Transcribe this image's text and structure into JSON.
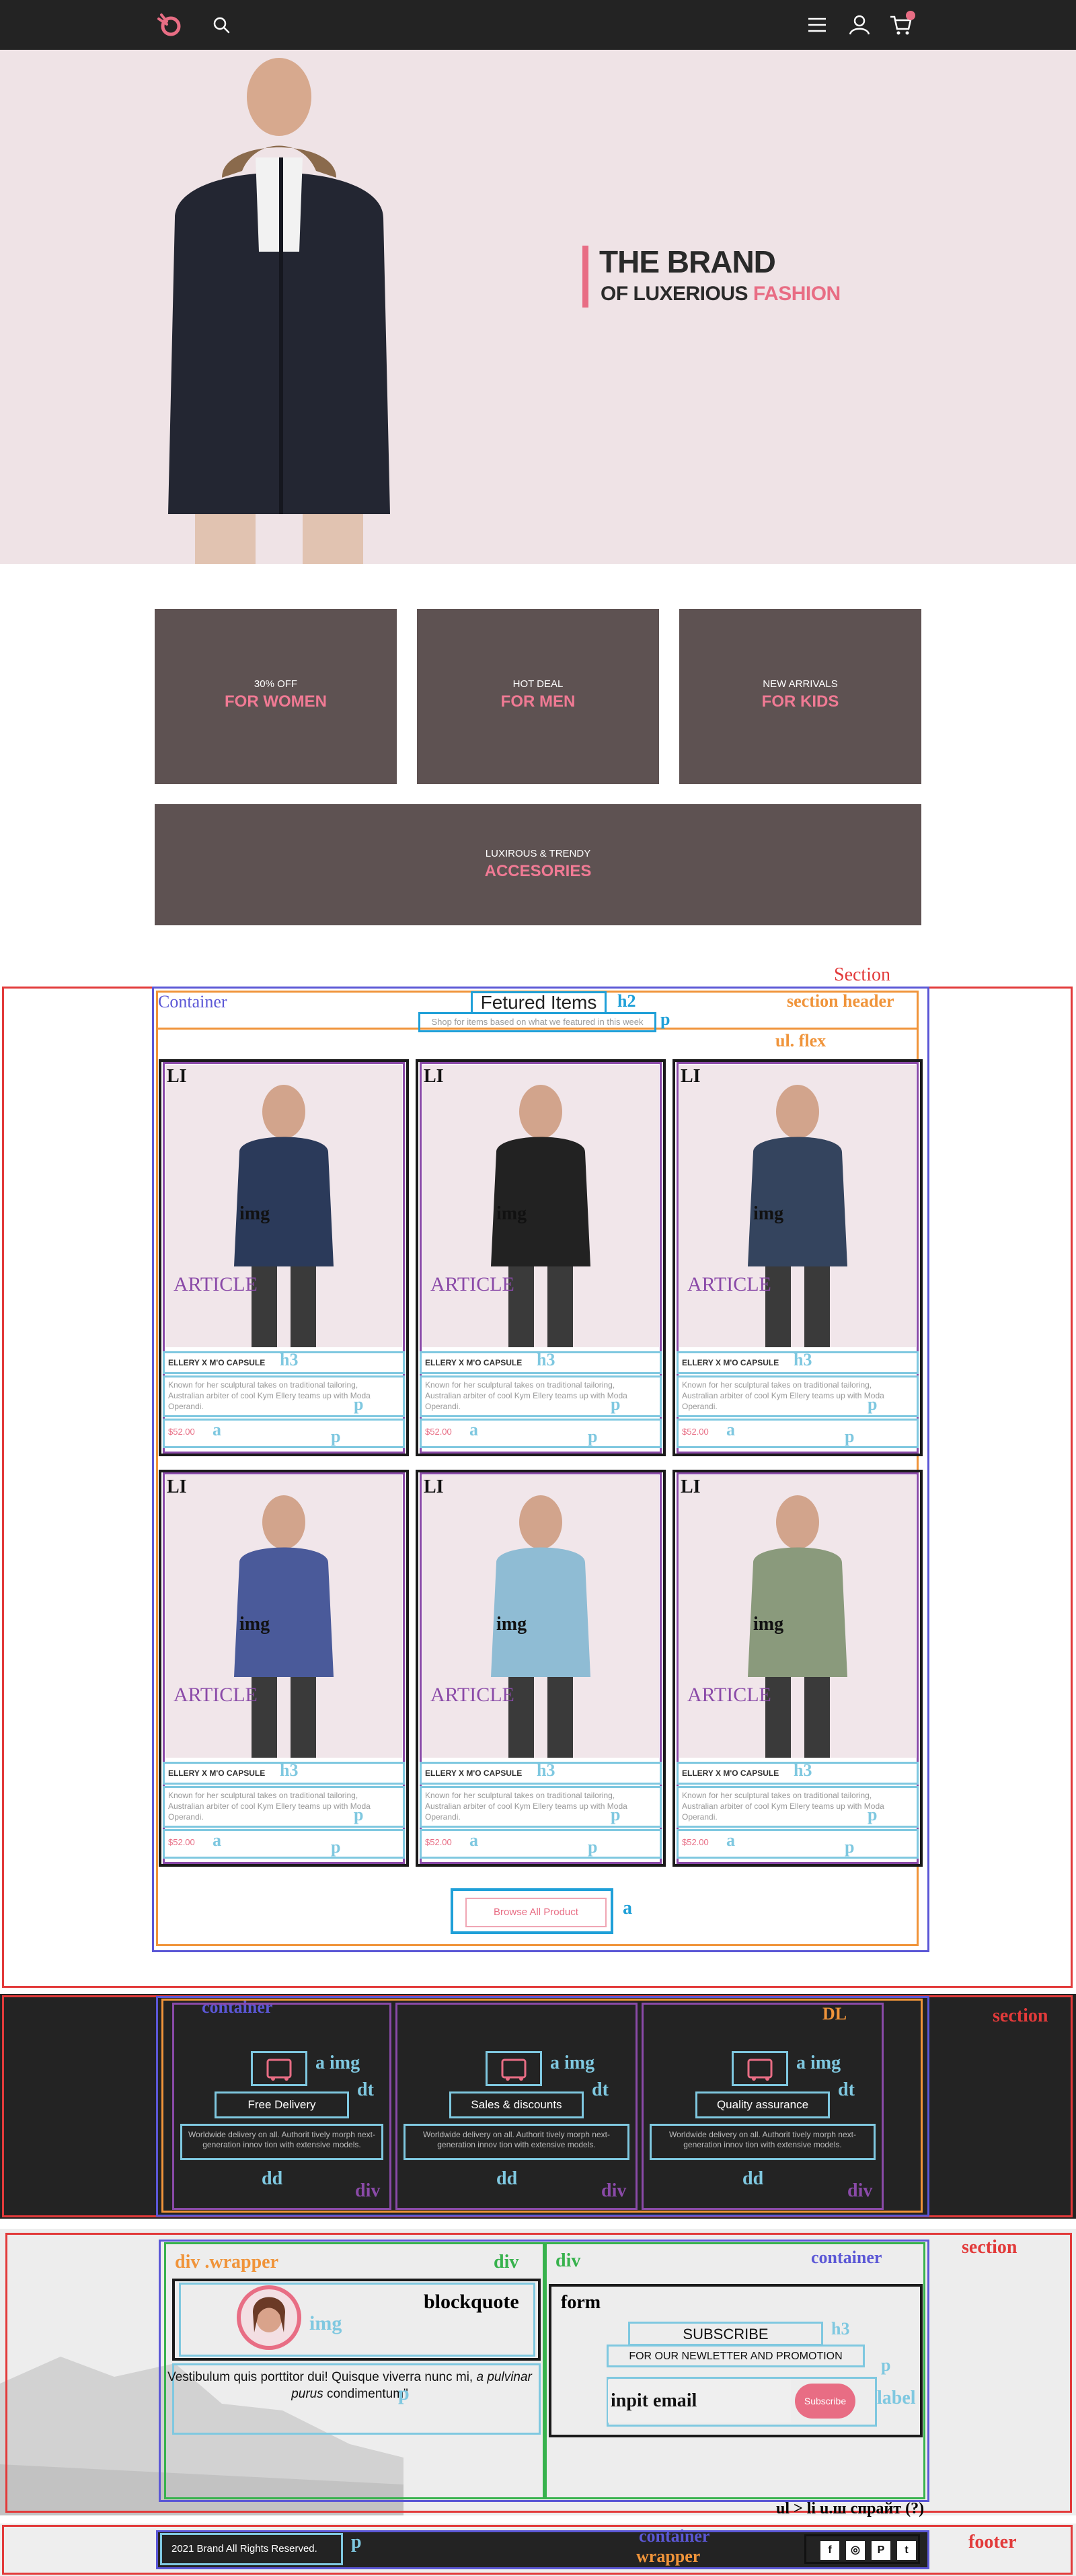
{
  "header": {
    "logo_icon": "brand-logo-icon",
    "search_icon": "search-icon",
    "menu_icon": "hamburger-menu-icon",
    "user_icon": "user-icon",
    "cart_icon": "cart-icon",
    "brand_color": "#e86d84"
  },
  "hero": {
    "title": "THE BRAND",
    "subtitle_prefix": "OF LUXERIOUS ",
    "subtitle_accent": "FASHION"
  },
  "promos": [
    {
      "small": "30% OFF",
      "big": "FOR WOMEN"
    },
    {
      "small": "HOT DEAL",
      "big": "FOR MEN"
    },
    {
      "small": "NEW ARRIVALS",
      "big": "FOR KIDS"
    }
  ],
  "promo_wide": {
    "small": "LUXIROUS & TRENDY",
    "big": "ACCESORIES"
  },
  "featured": {
    "title": "Fetured Items",
    "subtitle": "Shop for items based on what we featured in this week",
    "browse_label": "Browse All Product",
    "annotations": {
      "section": "Section",
      "container": "Container",
      "section_header": "section header",
      "h2": "h2",
      "p": "p",
      "ul_flex": "ul. flex",
      "li": "LI",
      "img": "img",
      "article": "ARTICLE",
      "h3": "h3",
      "a": "a"
    },
    "products": [
      {
        "name": "ELLERY X M'O CAPSULE",
        "desc": "Known for her sculptural takes on traditional tailoring, Australian arbiter of cool Kym Ellery teams up with Moda Operandi.",
        "price": "$52.00"
      },
      {
        "name": "ELLERY X M'O CAPSULE",
        "desc": "Known for her sculptural takes on traditional tailoring, Australian arbiter of cool Kym Ellery teams up with Moda Operandi.",
        "price": "$52.00"
      },
      {
        "name": "ELLERY X M'O CAPSULE",
        "desc": "Known for her sculptural takes on traditional tailoring, Australian arbiter of cool Kym Ellery teams up with Moda Operandi.",
        "price": "$52.00"
      },
      {
        "name": "ELLERY X M'O CAPSULE",
        "desc": "Known for her sculptural takes on traditional tailoring, Australian arbiter of cool Kym Ellery teams up with Moda Operandi.",
        "price": "$52.00"
      },
      {
        "name": "ELLERY X M'O CAPSULE",
        "desc": "Known for her sculptural takes on traditional tailoring, Australian arbiter of cool Kym Ellery teams up with Moda Operandi.",
        "price": "$52.00"
      },
      {
        "name": "ELLERY X M'O CAPSULE",
        "desc": "Known for her sculptural takes on traditional tailoring, Australian arbiter of cool Kym Ellery teams up with Moda Operandi.",
        "price": "$52.00"
      }
    ]
  },
  "features": {
    "annotations": {
      "container": "container",
      "dl": "DL",
      "section": "section",
      "a_img": "a img",
      "dt": "dt",
      "dd": "dd",
      "div": "div"
    },
    "items": [
      {
        "title": "Free Delivery",
        "desc": "Worldwide delivery on all. Authorit tively morph next-generation innov tion with extensive models.",
        "icon": "truck-icon"
      },
      {
        "title": "Sales & discounts",
        "desc": "Worldwide delivery on all. Authorit tively morph next-generation innov tion with extensive models.",
        "icon": "percent-icon"
      },
      {
        "title": "Quality assurance",
        "desc": "Worldwide delivery on all. Authorit tively morph next-generation innov tion with extensive models.",
        "icon": "crown-icon"
      }
    ]
  },
  "newsletter": {
    "annotations": {
      "div_wrapper": "div .wrapper",
      "div": "div",
      "container": "container",
      "section": "section",
      "blockquote": "blockquote",
      "img": "img",
      "p": "p",
      "form": "form",
      "h3": "h3",
      "label": "label",
      "input_label": "inpit email"
    },
    "quote_prefix": "Vestibulum quis porttitor dui! Quisque viverra nunc mi, ",
    "quote_italic": "a pulvinar purus",
    "quote_suffix": " condimentum\"",
    "subscribe_title": "SUBSCRIBE",
    "subscribe_sub": "FOR OUR NEWLETTER AND PROMOTION",
    "email_placeholder": "",
    "subscribe_button": "Subscribe"
  },
  "footer": {
    "copyright": "2021  Brand  All Rights Reserved.",
    "annotations": {
      "ul_note": "ul > li u.ш спрайт (?)",
      "footer": "footer",
      "container": "container",
      "wrapper": "wrapper",
      "p": "p"
    },
    "social": [
      "f",
      "◎",
      "P",
      "t"
    ]
  }
}
